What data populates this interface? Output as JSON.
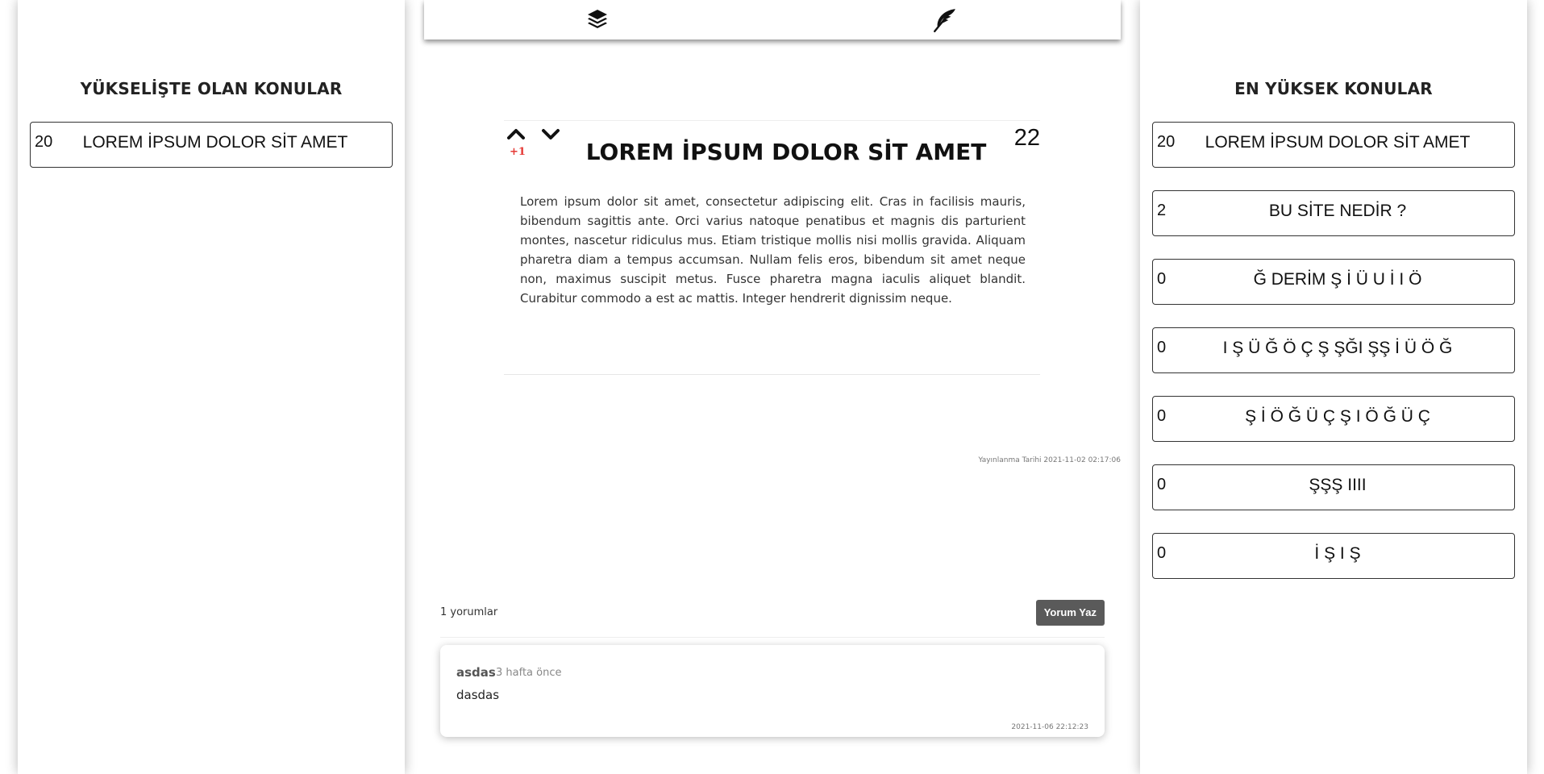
{
  "left_sidebar": {
    "title": "YÜKSELİŞTE OLAN KONULAR",
    "topics": [
      {
        "count": "20",
        "title": "LOREM İPSUM DOLOR SİT AMET"
      }
    ]
  },
  "right_sidebar": {
    "title": "EN YÜKSEK KONULAR",
    "topics": [
      {
        "count": "20",
        "title": "LOREM İPSUM DOLOR SİT AMET"
      },
      {
        "count": "2",
        "title": "BU SİTE NEDİR ?"
      },
      {
        "count": "0",
        "title": "Ğ DERİM Ş İ Ü U İ I Ö"
      },
      {
        "count": "0",
        "title": "I Ş Ü Ğ Ö Ç Ş ŞĞI ŞŞ İ Ü Ö Ğ"
      },
      {
        "count": "0",
        "title": "Ş İ Ö Ğ Ü Ç Ş I Ö Ğ Ü Ç"
      },
      {
        "count": "0",
        "title": "ŞŞŞ IIII"
      },
      {
        "count": "0",
        "title": "İ Ş I Ş"
      }
    ]
  },
  "topbar": {
    "icons": [
      "layers-icon",
      "feather-icon"
    ]
  },
  "post": {
    "vote_delta": "+1",
    "score": "22",
    "title": "LOREM İPSUM DOLOR SİT AMET",
    "body": "Lorem ipsum dolor sit amet, consectetur adipiscing elit. Cras in facilisis mauris, bibendum sagittis ante. Orci varius natoque penatibus et magnis dis parturient montes, nascetur ridiculus mus. Etiam tristique mollis nisi mollis gravida. Aliquam pharetra diam a tempus accumsan. Nullam felis eros, bibendum sit amet neque non, maximus suscipit metus. Fusce pharetra magna iaculis aliquet blandit. Curabitur commodo a est ac mattis. Integer hendrerit dignissim neque.",
    "published": "Yayınlanma Tarihi 2021-11-02 02:17:06"
  },
  "comments": {
    "count_label": "1 yorumlar",
    "write_button": "Yorum Yaz",
    "items": [
      {
        "user": "asdas",
        "ago": "3 hafta önce",
        "text": "dasdas",
        "date": "2021-11-06 22:12:23"
      }
    ]
  },
  "colors": {
    "vote_delta": "#e53935",
    "button_bg": "#5a5a5a"
  }
}
